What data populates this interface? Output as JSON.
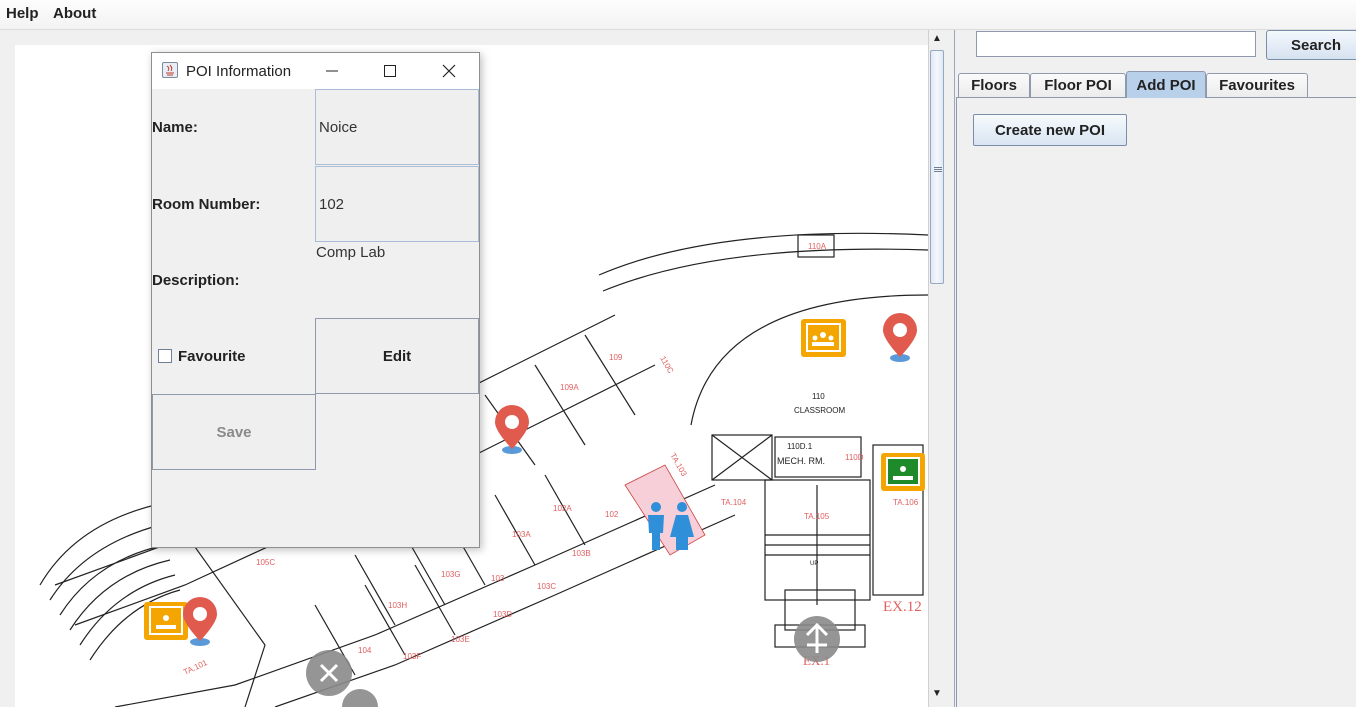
{
  "menu": {
    "help": "Help",
    "about": "About"
  },
  "search": {
    "value": "",
    "placeholder": "",
    "button": "Search"
  },
  "tabs": [
    {
      "label": "Floors"
    },
    {
      "label": "Floor POI"
    },
    {
      "label": "Add POI"
    },
    {
      "label": "Favourites"
    }
  ],
  "active_tab": "Add POI",
  "add_poi": {
    "create_button": "Create new POI"
  },
  "dialog": {
    "title": "POI Information",
    "name_label": "Name:",
    "name_value": "Noice",
    "room_label": "Room Number:",
    "room_value": "102",
    "description_label": "Description:",
    "description_value": "Comp Lab",
    "favourite_label": "Favourite",
    "favourite_checked": false,
    "edit_button": "Edit",
    "save_button": "Save"
  },
  "map": {
    "labels": {
      "r110a": "110A",
      "r110": "110",
      "classroom": "CLASSROOM",
      "r109": "109",
      "r109a": "109A",
      "r110c": "110C",
      "r110d1": "110D.1",
      "mech": "MECH. RM.",
      "r110d": "110D",
      "ta106": "TA.106",
      "ta104": "TA.104",
      "ta105": "TA.105",
      "ta103": "TA.103",
      "r102": "102",
      "r102a": "102A",
      "r103a": "103A",
      "r103b": "103B",
      "r103": "103",
      "r103c": "103C",
      "r103d": "103D",
      "r103e": "103E",
      "r103f": "103F",
      "r103g": "103G",
      "r103h": "103H",
      "r104": "104",
      "r105c": "105C",
      "ta101": "TA.101",
      "ex12": "EX.12",
      "ex1": "EX.1",
      "up": "UP"
    },
    "poi_colors": {
      "pin": "#e05a4e",
      "classroom": "#f5a500",
      "washroom": "#2f8fd8",
      "exit": "#8a8a8a"
    }
  }
}
